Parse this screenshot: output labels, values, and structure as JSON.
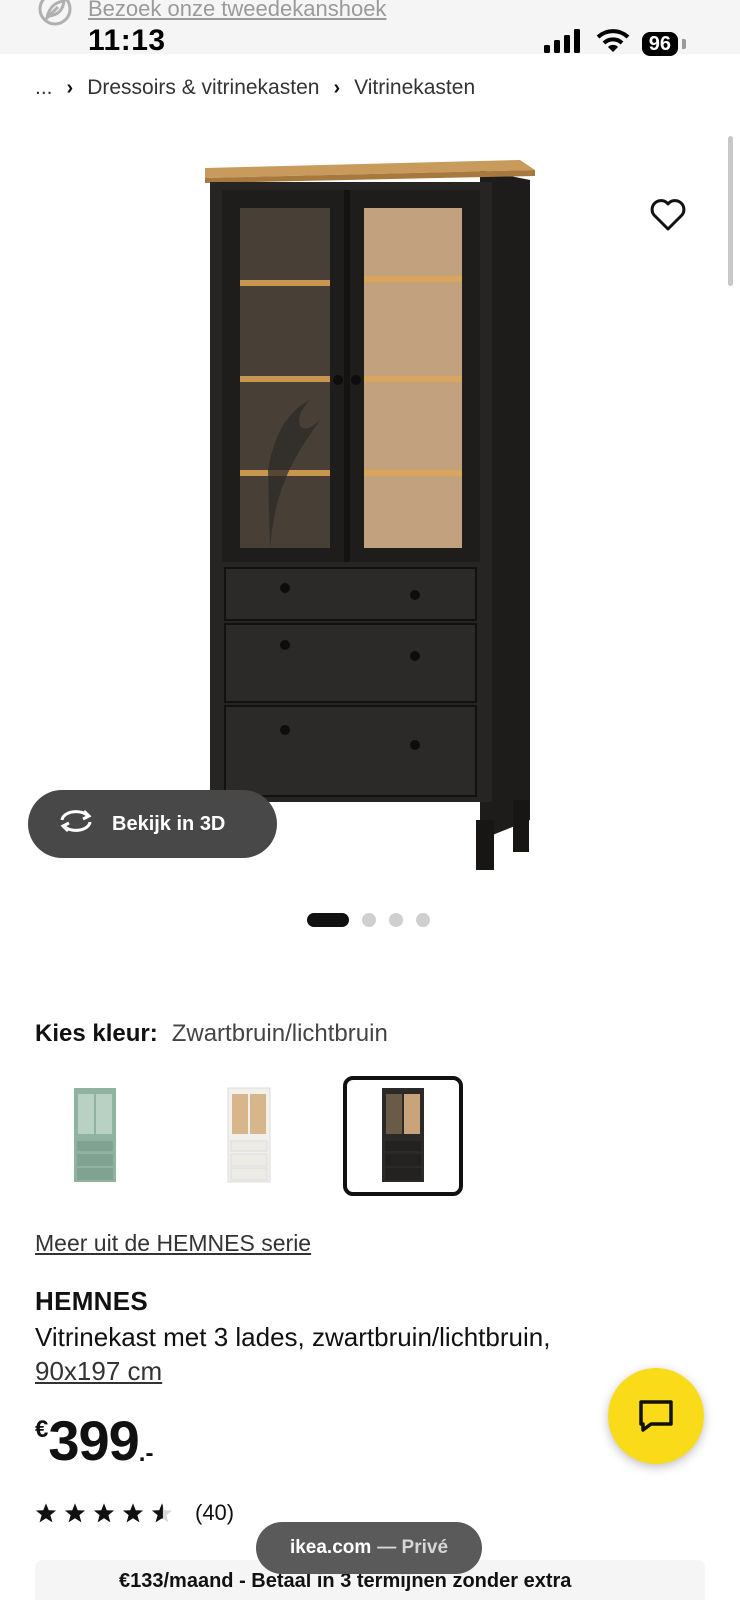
{
  "status_bar": {
    "promo_text": "Bezoek onze tweedekanshoek",
    "time": "11:13",
    "battery": "96"
  },
  "breadcrumb": {
    "ellipsis": "...",
    "items": [
      "Dressoirs & vitrinekasten",
      "Vitrinekasten"
    ]
  },
  "gallery": {
    "view_3d_label": "Bekijk in 3D",
    "image_count": 4,
    "active_index": 0
  },
  "color_picker": {
    "label": "Kies kleur:",
    "selected_value": "Zwartbruin/lichtbruin",
    "swatches": [
      {
        "color": "#8fb3a0",
        "selected": false
      },
      {
        "color": "#f2f0ea",
        "selected": false
      },
      {
        "color": "#2b2a28",
        "selected": true
      }
    ]
  },
  "series_link": "Meer uit de HEMNES serie",
  "product": {
    "brand": "HEMNES",
    "description": "Vitrinekast met 3 lades, zwartbruin/lichtbruin,",
    "size": "90x197 cm",
    "price_currency": "€",
    "price_amount": "399",
    "price_suffix": ".-",
    "rating_value": 4.5,
    "rating_count": "(40)"
  },
  "installment_text": "€133/maand - Betaal in 3 termijnen zonder extra",
  "browser": {
    "domain": "ikea.com",
    "mode": "— Privé"
  },
  "colors": {
    "accent_yellow": "#fadb19",
    "pill_dark": "#484848"
  }
}
